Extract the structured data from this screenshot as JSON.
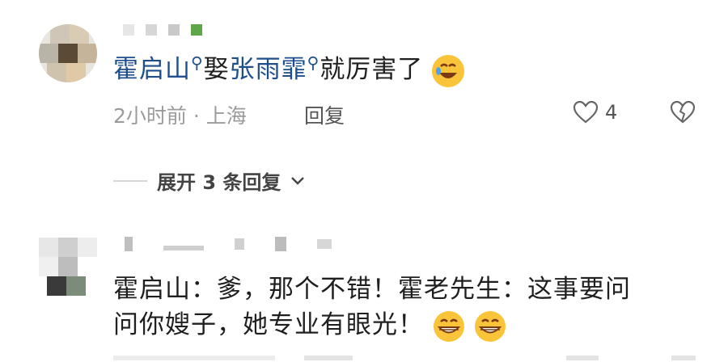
{
  "comments": [
    {
      "text_prefix": "霍启山",
      "text_mid": "娶",
      "text_link": "张雨霏",
      "text_suffix": "就厉害了",
      "emoji": "rofl-emoji",
      "time": "2小时前",
      "location": "上海",
      "reply_label": "回复",
      "likes": "4",
      "expand_label": "展开 3 条回复"
    },
    {
      "line1": "霍启山：爹，那个不错！霍老先生：这事要问",
      "line2": "问你嫂子，她专业有眼光！",
      "emojis": [
        "grin-emoji",
        "grin-emoji"
      ]
    }
  ],
  "colors": {
    "link": "#1e4e8c",
    "meta": "#9b9b9b",
    "text": "#1f1f1f"
  }
}
